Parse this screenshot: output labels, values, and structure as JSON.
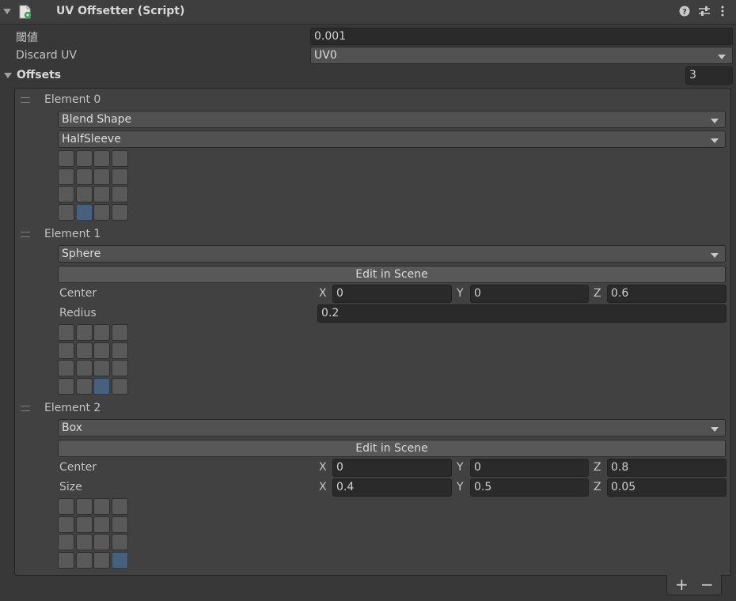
{
  "header": {
    "title": "UV Offsetter (Script)",
    "script_icon": "script-file-icon",
    "help_icon": "help-icon",
    "presets_icon": "presets-icon",
    "menu_icon": "kebab-menu-icon"
  },
  "threshold": {
    "label": "閾値",
    "value": "0.001"
  },
  "discard_uv": {
    "label": "Discard UV",
    "value": "UV0"
  },
  "offsets": {
    "label": "Offsets",
    "count": "3"
  },
  "elements": [
    {
      "label": "Element 0",
      "type": "Blend Shape",
      "blend_shape": "HalfSleeve",
      "selected_cell": {
        "row": 3,
        "col": 1
      }
    },
    {
      "label": "Element 1",
      "type": "Sphere",
      "edit_button": "Edit in Scene",
      "center": {
        "label": "Center",
        "x_label": "X",
        "x": "0",
        "y_label": "Y",
        "y": "0",
        "z_label": "Z",
        "z": "0.6"
      },
      "radius": {
        "label": "Redius",
        "value": "0.2"
      },
      "selected_cell": {
        "row": 3,
        "col": 2
      }
    },
    {
      "label": "Element 2",
      "type": "Box",
      "edit_button": "Edit in Scene",
      "center": {
        "label": "Center",
        "x_label": "X",
        "x": "0",
        "y_label": "Y",
        "y": "0",
        "z_label": "Z",
        "z": "0.8"
      },
      "size": {
        "label": "Size",
        "x_label": "X",
        "x": "0.4",
        "y_label": "Y",
        "y": "0.5",
        "z_label": "Z",
        "z": "0.05"
      },
      "selected_cell": {
        "row": 3,
        "col": 3
      }
    }
  ],
  "footer": {
    "add_label": "+",
    "remove_label": "−"
  },
  "colors": {
    "background": "#383838",
    "field": "#2a2a2a",
    "selected_cell": "#46607e",
    "script_icon_green": "#3fa34d"
  }
}
